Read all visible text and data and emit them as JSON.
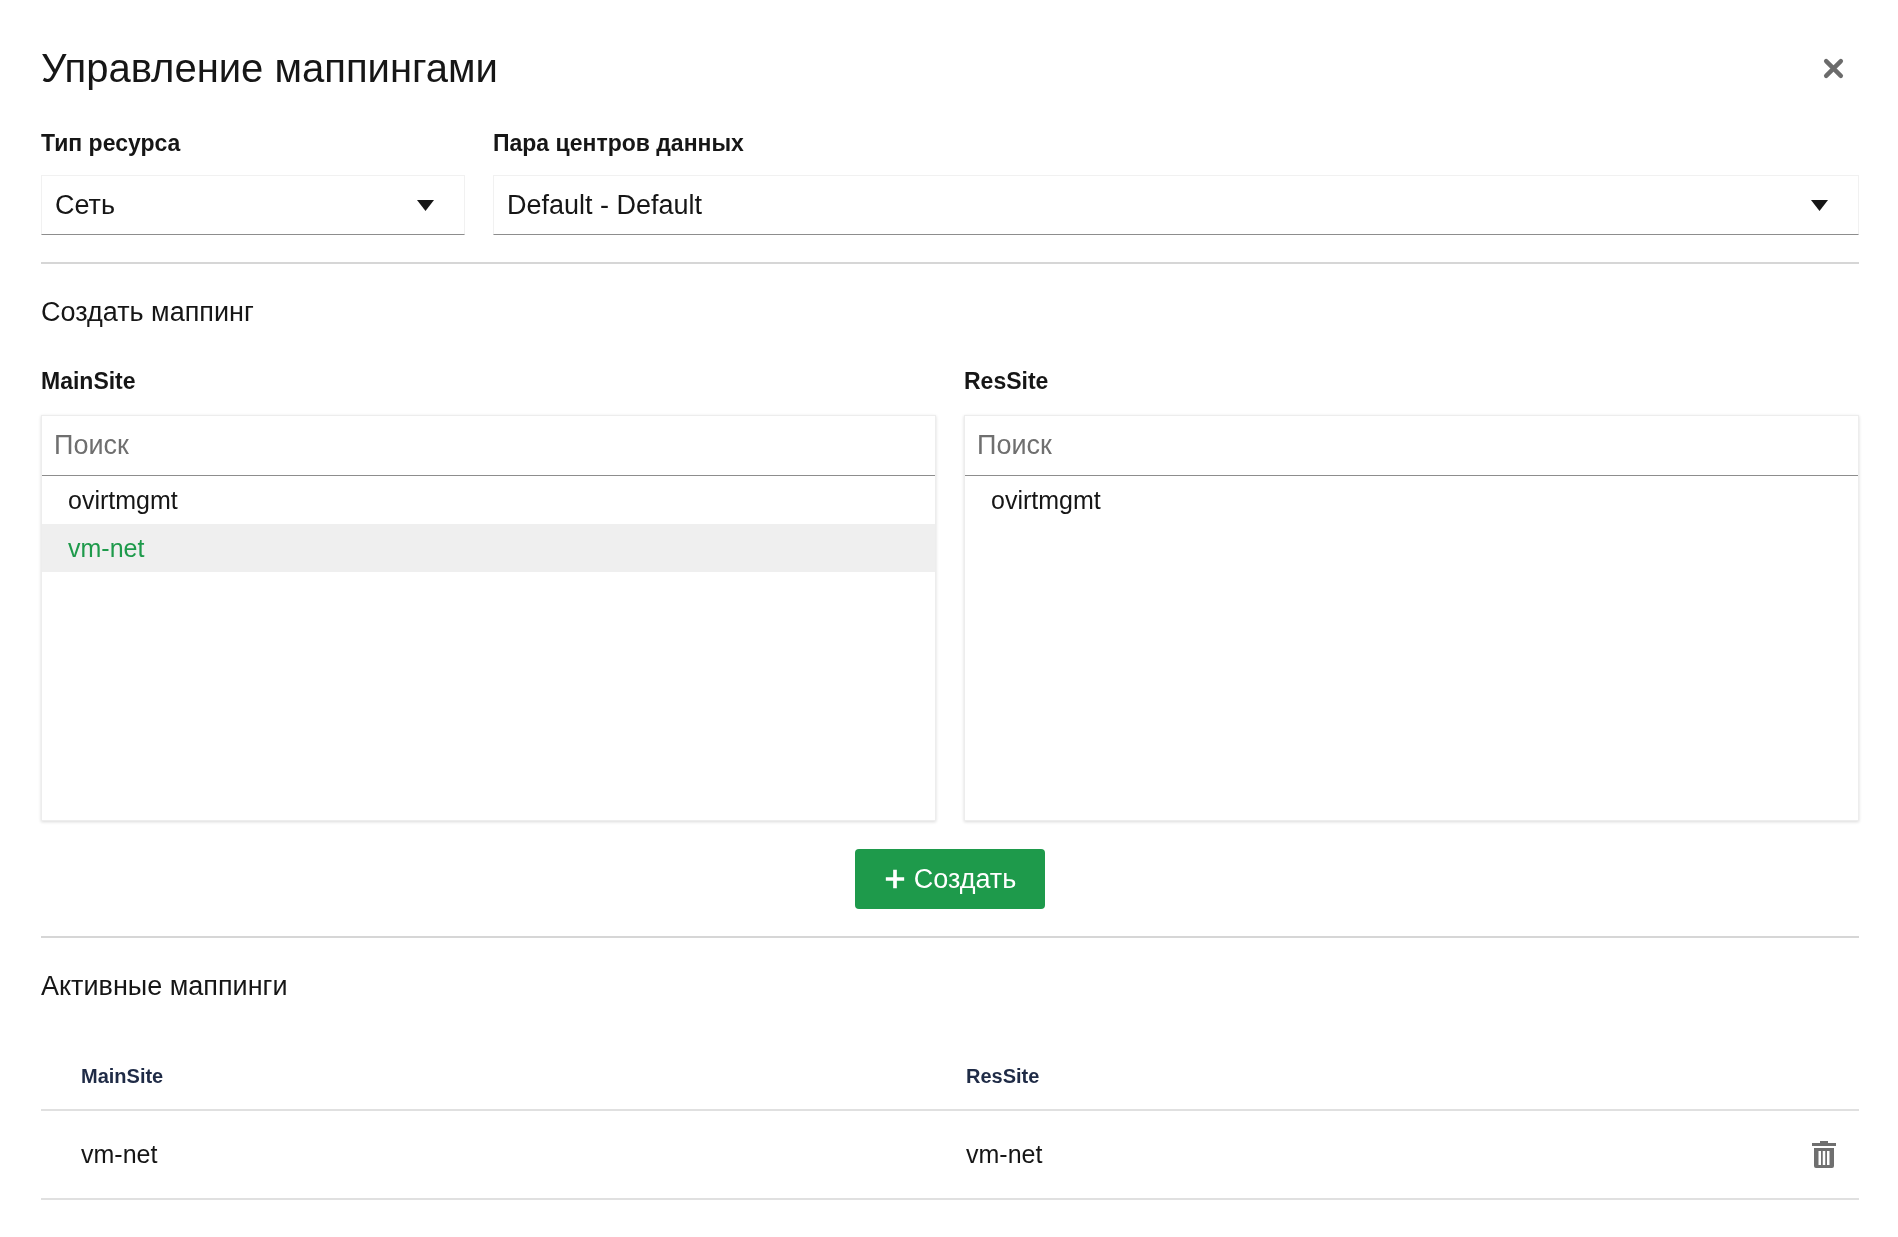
{
  "dialog": {
    "title": "Управление маппингами"
  },
  "filters": [
    {
      "label": "Тип ресурса",
      "value": "Сеть"
    },
    {
      "label": "Пара центров данных",
      "value": "Default - Default"
    }
  ],
  "create_section": {
    "heading": "Создать маппинг",
    "lists": [
      {
        "label": "MainSite",
        "search": {
          "placeholder": "Поиск"
        },
        "items": [
          {
            "text": "ovirtmgmt",
            "selected": false
          },
          {
            "text": "vm-net",
            "selected": true
          }
        ]
      },
      {
        "label": "ResSite",
        "search": {
          "placeholder": "Поиск"
        },
        "items": [
          {
            "text": "ovirtmgmt",
            "selected": false
          }
        ]
      }
    ],
    "create_button": {
      "label": "Создать"
    }
  },
  "active_section": {
    "heading": "Активные маппинги",
    "table": {
      "columns": [
        "MainSite",
        "ResSite"
      ],
      "rows": [
        {
          "cells": [
            "vm-net",
            "vm-net"
          ]
        }
      ]
    }
  }
}
